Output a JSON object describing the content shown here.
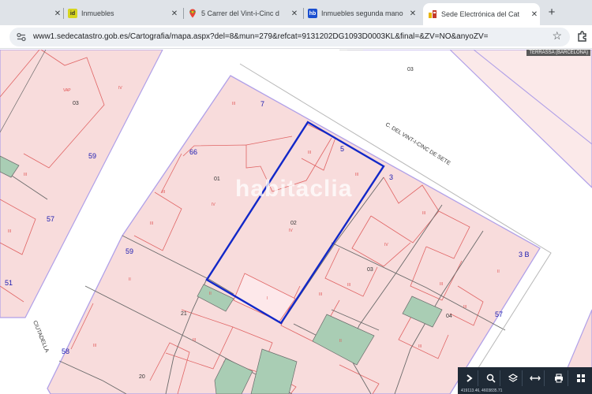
{
  "browser": {
    "tabs": [
      {
        "title": "",
        "favicon": "generic-page-icon",
        "active": false
      },
      {
        "title": "Inmuebles",
        "favicon": "idealista-icon",
        "active": false
      },
      {
        "title": "5 Carrer del Vint-i-Cinc d",
        "favicon": "google-maps-icon",
        "active": false
      },
      {
        "title": "Inmuebles segunda mano",
        "favicon": "habitaclia-icon",
        "active": false
      },
      {
        "title": "Sede Electrónica del Cat",
        "favicon": "catastro-icon",
        "active": true
      }
    ],
    "new_tab_symbol": "+",
    "close_symbol": "✕",
    "url": "www1.sedecatastro.gob.es/Cartografia/mapa.aspx?del=8&mun=279&refcat=9131202DG1093D0003KL&final=&ZV=NO&anyoZV=",
    "colors": {
      "tab_strip": "#dfe3e8",
      "omnibox": "#edf0f4"
    }
  },
  "map": {
    "municipality": "TERRASSA (BARCELONA)",
    "watermark": "habitaclia",
    "street_vint_i_cinc": "C. DEL VINT-I-CINC DE SETE",
    "street_ciutadella": "CIUTADELLA",
    "parcels": {
      "p03_top": "03",
      "p03_left": "03",
      "p01": "01",
      "p02": "02",
      "p03": "03",
      "p04": "04",
      "p21": "21",
      "p20": "20"
    },
    "numbers": {
      "n7": "7",
      "n66": "66",
      "n5": "5",
      "n3": "3",
      "n59a": "59",
      "n57a": "57",
      "n51": "51",
      "n59b": "59",
      "n3b": "3 B",
      "n57b": "57",
      "n58": "58"
    },
    "floors": {
      "iv": "IV",
      "iii": "III",
      "ii": "II",
      "i": "I",
      "vap": "VAP"
    },
    "coordinates": "419113.46, 4603835.71",
    "colors": {
      "parcel_fill": "#f8dcdc",
      "parcel_line": "#b0a0e8",
      "sub_line": "#e06464",
      "patio": "#a9cdb4",
      "selected": "#1228c8",
      "label_blue": "#1a1ab0",
      "toolbar": "#1f2a36"
    }
  },
  "map_tools": [
    {
      "icon": "chevron-right-icon"
    },
    {
      "icon": "search-icon"
    },
    {
      "icon": "layers-icon"
    },
    {
      "icon": "measure-icon"
    },
    {
      "icon": "print-icon"
    },
    {
      "icon": "grid-icon"
    }
  ]
}
